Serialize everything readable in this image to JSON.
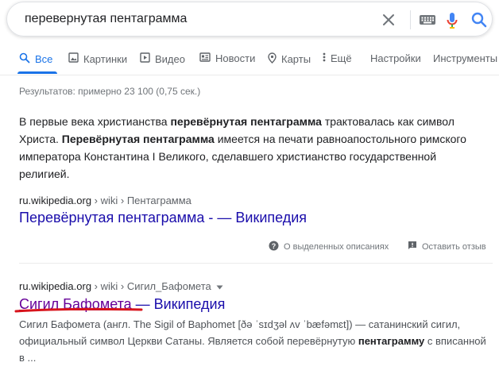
{
  "search": {
    "query": "перевернутая пентаграмма"
  },
  "tabs": [
    {
      "label": "Все"
    },
    {
      "label": "Картинки"
    },
    {
      "label": "Видео"
    },
    {
      "label": "Новости"
    },
    {
      "label": "Карты"
    },
    {
      "label": "Ещё"
    },
    {
      "label": "Настройки"
    },
    {
      "label": "Инструменты"
    }
  ],
  "stats": "Результатов: примерно 23 100 (0,75 сек.)",
  "featured": {
    "p1": "В первые века христианства ",
    "b1": "перевёрнутая пентаграмма",
    "p2": " трактовалась как символ Христа. ",
    "b2": "Перевёрнутая пентаграмма",
    "p3": " имеется на печати равноапостольного римского императора Константина I Великого, сделавшего христианство государственной религией."
  },
  "result1": {
    "domain": "ru.wikipedia.org",
    "path": " › wiki › Пентаграмма",
    "title": "Перевёрнутая пентаграмма - — Википедия"
  },
  "feedback": {
    "about": "О выделенных описаниях",
    "report": "Оставить отзыв"
  },
  "result2": {
    "domain": "ru.wikipedia.org",
    "path": " › wiki › Сигил_Бафомета",
    "title_part1": "Сигил Бафомета",
    "title_part2": " — Википедия",
    "desc_p1": "Сигил Бафомета (англ. The Sigil of Baphomet [ðə ˈsɪdʒəl ʌv ˈbæfəmɛt]) — сатанинский сигил, официальный символ Церкви Сатаны. Является собой перевёрнутую ",
    "desc_b": "пентаграмму",
    "desc_p2": " с вписанной в ..."
  },
  "colors": {
    "link": "#1a0dab",
    "visited": "#660099",
    "accent": "#1a73e8",
    "annotation": "#d8141c"
  }
}
